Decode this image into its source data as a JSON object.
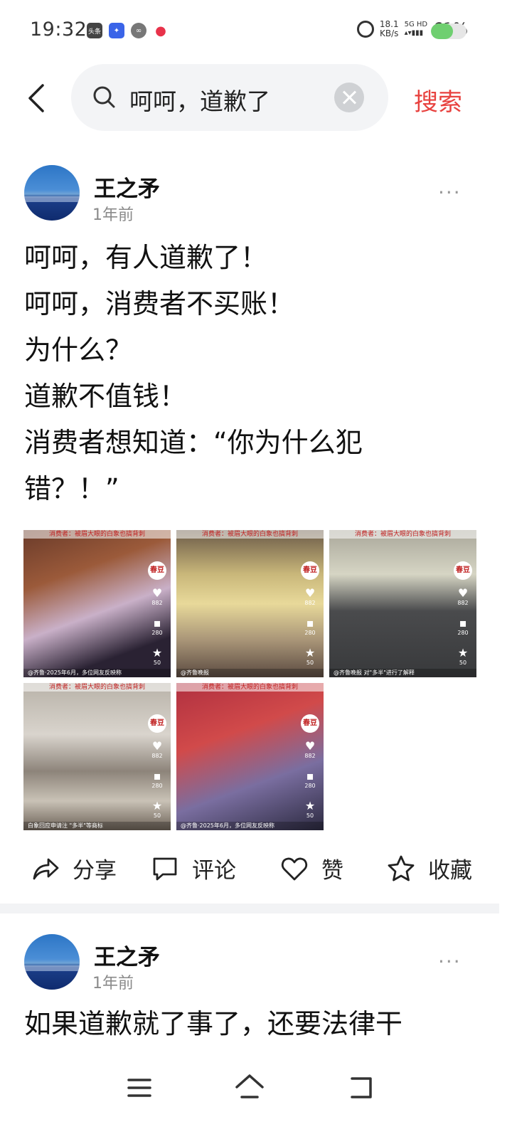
{
  "status_bar": {
    "time": "19:32",
    "app_icons": [
      "toutiao-app-icon",
      "app-blue-icon",
      "app-gray-icon",
      "video-app-icon"
    ],
    "app_toutiao_label": "头条",
    "net_speed_value": "18.1",
    "net_speed_unit": "KB/s",
    "signal_label": "5G HD",
    "battery_percent": "61%",
    "battery_level": 0.61,
    "battery_color": "#6fcf70"
  },
  "header": {
    "search_text": "呵呵，道歉了",
    "search_button": "搜索",
    "accent_color": "#e8423f"
  },
  "post1": {
    "author": "王之矛",
    "time": "1年前",
    "more": "···",
    "lines": [
      "呵呵，有人道歉了！",
      "呵呵，消费者不买账！",
      "为什么？",
      "道歉不值钱！",
      "消费者想知道：“你为什么犯",
      "错？！”"
    ],
    "thumb_caption": "消费者：被眉大眼的白象也搞背刺",
    "thumb_badge": "春豆",
    "thumb_stats": {
      "likes": "882",
      "comments": "280",
      "favorites": "50"
    },
    "thumb_bottoms": [
      "@齐鲁·2025年6月，多位网友反映称",
      "@齐鲁晚报",
      "@齐鲁晚报 对\"多半\"进行了解释",
      "白象回应申请注 \"多半\"等商标",
      "@齐鲁·2025年6月，多位网友反映称"
    ]
  },
  "actions": {
    "share": "分享",
    "comment": "评论",
    "like": "赞",
    "favorite": "收藏"
  },
  "post2": {
    "author": "王之矛",
    "time": "1年前",
    "more": "···",
    "first_line": "如果道歉就了事了，还要法律干"
  },
  "nav": {
    "buttons": [
      "menu-icon",
      "home-icon",
      "back-nav-icon"
    ]
  }
}
